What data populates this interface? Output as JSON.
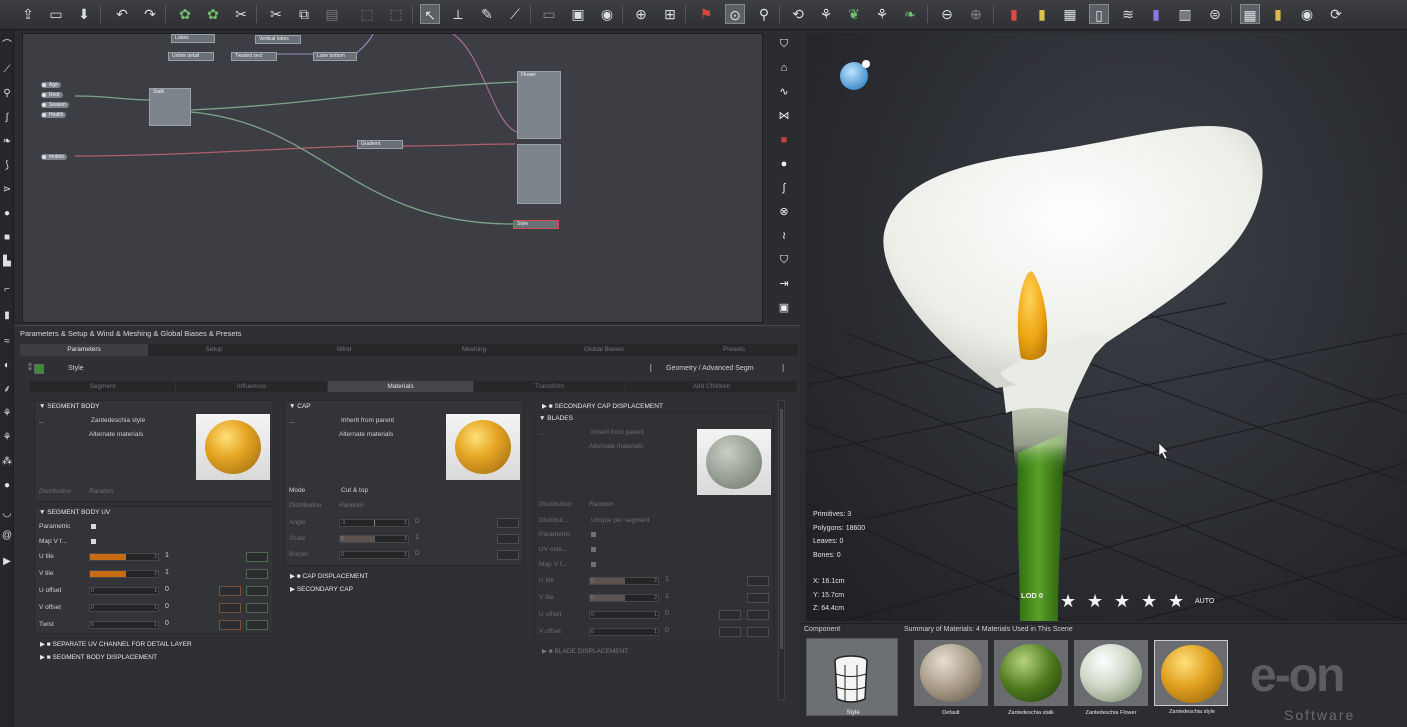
{
  "toolbar": {
    "icons": [
      "open-icon",
      "save-icon",
      "import-icon",
      "undo-icon",
      "redo-icon",
      "plant-icon",
      "plant-variant-icon",
      "scissors-plant-icon",
      "cut-icon",
      "copy-icon",
      "paste-icon",
      "group-icon",
      "ungroup-icon",
      "select-arrow-icon",
      "move-icon",
      "pencil-icon",
      "knife-icon",
      "frame-icon",
      "render-area-icon",
      "camera-icon",
      "add-layer-icon",
      "add-object-icon",
      "pin-icon",
      "material-icon",
      "zoom-icon",
      "rotate-icon",
      "branch-icon",
      "leaf-icon",
      "frond-icon",
      "sweep-icon",
      "remove-icon",
      "add-icon",
      "cylinder-red-icon",
      "cylinder-yellow-icon",
      "cylinder-gray-icon",
      "cylinder-white-icon",
      "spring-icon",
      "cylinder-purple-icon",
      "mesh-icon",
      "cylinder-lines-icon",
      "grid-icon",
      "ruler-icon",
      "compass-icon",
      "refresh-icon"
    ]
  },
  "graph": {
    "inputs": [
      "Age",
      "Root",
      "Season",
      "Health",
      "motion"
    ],
    "nodes": {
      "lobes": "Lobes",
      "stalk": "Stalk",
      "gradient": "Gradient",
      "flower": "Flower",
      "style": "Style",
      "vertical_lobes": "Vertical lobes",
      "unlinked": "Unlink detail",
      "twisted": "Twisted sect",
      "lobe_bottom": "Lobe bottom"
    }
  },
  "params": {
    "title": "Parameters & Setup & Wind & Meshing & Global Biases & Presets",
    "tabs": [
      "Parameters",
      "Setup",
      "Wind",
      "Meshing",
      "Global Biases",
      "Presets"
    ],
    "active_tab": "Parameters",
    "style_label": "Style",
    "breadcrumb": "Geometry / Advanced Segm",
    "sub_tabs": [
      "Segment",
      "Influences",
      "Materials",
      "Transform",
      "Add Children"
    ],
    "active_sub_tab": "Materials",
    "segment_body": {
      "header": "SEGMENT BODY",
      "material": "Zantedeschia style",
      "alternate": "Alternate materials",
      "dots": "...",
      "distribution_label": "Distribution",
      "distribution_value": "Random"
    },
    "segment_body_uv": {
      "header": "SEGMENT BODY UV",
      "parametric": "Parametric",
      "map_v": "Map V f...",
      "rows": [
        {
          "label": "U tile",
          "value": "1"
        },
        {
          "label": "V tile",
          "value": "1"
        },
        {
          "label": "U offset",
          "value": "0"
        },
        {
          "label": "V offset",
          "value": "0"
        },
        {
          "label": "Twist",
          "value": "0"
        }
      ],
      "slider_min": "0",
      "slider_max": "2",
      "slider_max_one": "1"
    },
    "collapsed_left": [
      "SEPARATE UV CHANNEL FOR DETAIL LAYER",
      "SEGMENT BODY DISPLACEMENT"
    ],
    "cap": {
      "header": "CAP",
      "material": "Inherit from parent",
      "alternate": "Alternate materials",
      "dots": "...",
      "mode_label": "Mode",
      "mode_value": "Cut & top",
      "distribution_label": "Distribution",
      "distribution_value": "Random",
      "rows": [
        {
          "label": "Angle",
          "value": "0",
          "min": "-1",
          "max": "1"
        },
        {
          "label": "Scale",
          "value": "1",
          "min": "0",
          "max": "2"
        },
        {
          "label": "Border",
          "value": "0",
          "min": "0",
          "max": "1"
        }
      ]
    },
    "collapsed_mid": [
      "CAP DISPLACEMENT",
      "SECONDARY CAP"
    ],
    "secondary_cap_displacement": "SECONDARY CAP DISPLACEMENT",
    "blades": {
      "header": "BLADES",
      "material": "Inherit from parent",
      "alternate": "Alternate materials",
      "dots": "...",
      "distribution_label": "Distribution",
      "distribution_value": "Random",
      "distrib_label": "Distribut...",
      "distrib_value": "Unique per segment",
      "parametric": "Parametric",
      "uv_ext": "UV exte...",
      "map_v": "Map V f...",
      "rows": [
        {
          "label": "U tile",
          "value": "1"
        },
        {
          "label": "V tile",
          "value": "1"
        },
        {
          "label": "U offset",
          "value": "0"
        },
        {
          "label": "V offset",
          "value": "0"
        }
      ]
    },
    "blade_displacement": "BLADE DISPLACEMENT"
  },
  "viewport": {
    "stats": [
      {
        "label": "Primitives:",
        "value": "3"
      },
      {
        "label": "Polygons:",
        "value": "18600"
      },
      {
        "label": "Leaves:",
        "value": "0"
      },
      {
        "label": "Bones:",
        "value": "0"
      }
    ],
    "coords": [
      {
        "label": "X:",
        "value": "16.1cm"
      },
      {
        "label": "Y:",
        "value": "15.7cm"
      },
      {
        "label": "Z:",
        "value": "64.4cm"
      }
    ],
    "lod": "LOD 0",
    "lod_stars": 5,
    "auto": "AUTO"
  },
  "bottom": {
    "component_label": "Component",
    "component_name": "Style",
    "summary": "Summary of Materials: 4 Materials Used in This Scene",
    "materials": [
      {
        "name": "Default",
        "color": "#9d9283"
      },
      {
        "name": "Zantedeschia stalk",
        "color": "#4f7a1e"
      },
      {
        "name": "Zantedeschia Flower",
        "color": "#cfd8c7"
      },
      {
        "name": "Zantedeschia style",
        "color": "#e0a020"
      }
    ],
    "brand_top": "e-on",
    "brand_bottom": "Software"
  },
  "colors": {
    "accent_orange": "#c96b12",
    "flower_white": "#f4f6f2",
    "stem_green": "#3f8c1c",
    "spadix_yellow": "#f0b418"
  }
}
